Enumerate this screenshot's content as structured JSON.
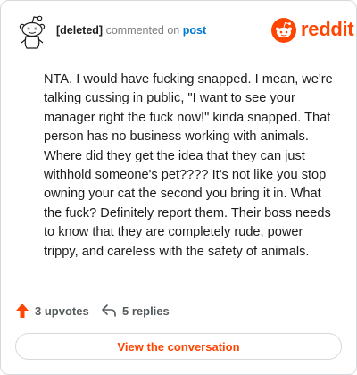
{
  "header": {
    "author": "[deleted]",
    "action_text": "commented on",
    "post_link": "post",
    "brand_name": "reddit",
    "avatar_icon": "snoo-avatar-icon",
    "logo_icon": "reddit-logo-icon"
  },
  "comment": {
    "body": "NTA. I would have fucking snapped. I mean, we're talking cussing in public, \"I want to see your manager right the fuck now!\" kinda snapped. That person has no business working with animals. Where did they get the idea that they can just withhold someone's pet???? It's not like you stop owning your cat the second you bring it in. What the fuck? Definitely report them. Their boss needs to know that they are completely rude, power trippy, and careless with the safety of animals."
  },
  "footer": {
    "upvotes_label": "3 upvotes",
    "replies_label": "5 replies",
    "view_button": "View the conversation",
    "upvote_icon": "upvote-arrow-icon",
    "reply_icon": "reply-arrow-icon"
  },
  "colors": {
    "brand": "#ff4500",
    "link": "#0079d3",
    "muted": "#7c7c7c",
    "border": "#d7dadc"
  }
}
